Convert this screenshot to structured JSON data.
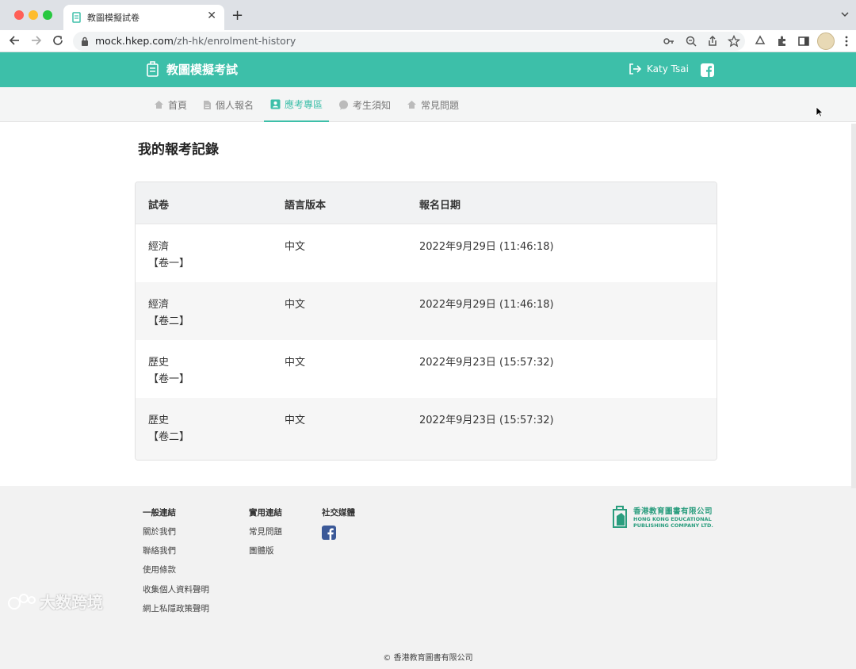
{
  "browser": {
    "tab_title": "教圖模擬試卷",
    "url_host": "mock.hkep.com",
    "url_path": "/zh-hk/enrolment-history"
  },
  "site": {
    "brand": "教圖模擬考試",
    "user_name": "Katy Tsai",
    "colors": {
      "accent": "#3dbfa9",
      "logo": "#2a9d7e"
    }
  },
  "nav": {
    "items": [
      {
        "label": "首頁",
        "icon": "home-icon"
      },
      {
        "label": "個人報名",
        "icon": "document-icon"
      },
      {
        "label": "應考專區",
        "icon": "id-card-icon",
        "active": true
      },
      {
        "label": "考生須知",
        "icon": "chat-icon"
      },
      {
        "label": "常見問題",
        "icon": "home-icon"
      }
    ]
  },
  "main": {
    "title": "我的報考記錄",
    "table": {
      "headers": [
        "試卷",
        "語言版本",
        "報名日期"
      ],
      "rows": [
        {
          "subject": "經濟",
          "paper": "【卷一】",
          "language": "中文",
          "date": "2022年9月29日 (11:46:18)"
        },
        {
          "subject": "經濟",
          "paper": "【卷二】",
          "language": "中文",
          "date": "2022年9月29日 (11:46:18)"
        },
        {
          "subject": "歷史",
          "paper": "【卷一】",
          "language": "中文",
          "date": "2022年9月23日 (15:57:32)"
        },
        {
          "subject": "歷史",
          "paper": "【卷二】",
          "language": "中文",
          "date": "2022年9月23日 (15:57:32)"
        }
      ]
    }
  },
  "footer": {
    "general_title": "一般連結",
    "general_links": [
      "關於我們",
      "聯絡我們",
      "使用條款",
      "收集個人資料聲明",
      "網上私隱政策聲明"
    ],
    "useful_title": "實用連結",
    "useful_links": [
      "常見問題",
      "團體版"
    ],
    "social_title": "社交媒體",
    "logo_cn": "香港教育圖書有限公司",
    "logo_en_1": "HONG KONG EDUCATIONAL",
    "logo_en_2": "PUBLISHING COMPANY LTD.",
    "copyright": "© 香港教育圖書有限公司"
  },
  "watermark": "大数跨境"
}
